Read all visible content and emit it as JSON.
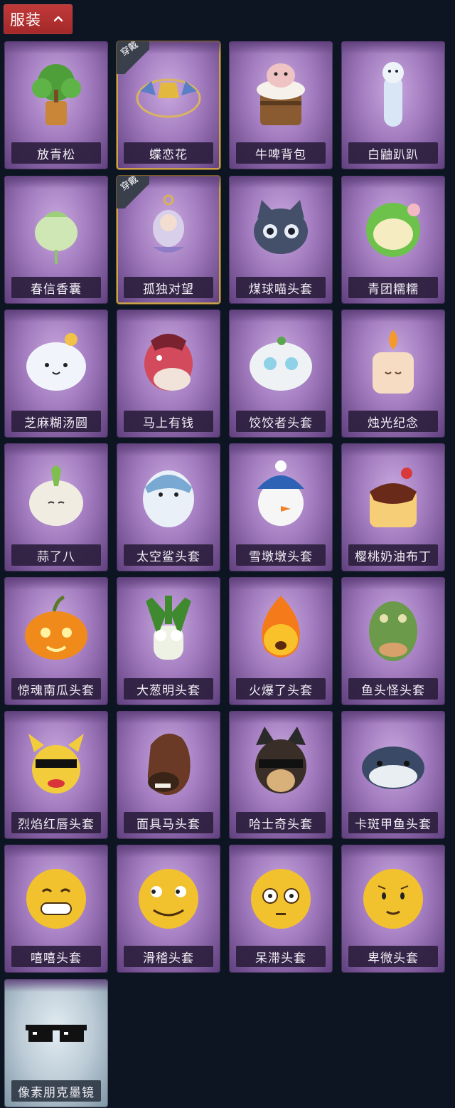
{
  "header": {
    "tab_label": "服装",
    "toggle_icon": "chevron-up-icon"
  },
  "worn_badge_label": "穿戴",
  "colors": {
    "background": "#0d1523",
    "tab_red": "#b32f2f",
    "card_purple": "#a27bbf",
    "card_silver": "#bccbd6",
    "worn_border_gold": "#c9a24a"
  },
  "items": [
    {
      "name": "放青松",
      "icon": "bonsai-pine-icon",
      "worn": false,
      "rarity": "purple"
    },
    {
      "name": "蝶恋花",
      "icon": "butterfly-bell-ornament-icon",
      "worn": true,
      "rarity": "purple"
    },
    {
      "name": "牛啤背包",
      "icon": "cow-beer-mug-backpack-icon",
      "worn": false,
      "rarity": "purple"
    },
    {
      "name": "白鼬趴趴",
      "icon": "white-weasel-plush-icon",
      "worn": false,
      "rarity": "purple"
    },
    {
      "name": "春信香囊",
      "icon": "sachet-pouch-icon",
      "worn": false,
      "rarity": "purple"
    },
    {
      "name": "孤独对望",
      "icon": "girl-charm-pendant-icon",
      "worn": true,
      "rarity": "purple"
    },
    {
      "name": "煤球喵头套",
      "icon": "gray-cat-head-icon",
      "worn": false,
      "rarity": "purple"
    },
    {
      "name": "青团糯糯",
      "icon": "green-rice-ball-icon",
      "worn": false,
      "rarity": "purple"
    },
    {
      "name": "芝麻糊汤圆",
      "icon": "sesame-dumpling-icon",
      "worn": false,
      "rarity": "purple"
    },
    {
      "name": "马上有钱",
      "icon": "red-horse-head-icon",
      "worn": false,
      "rarity": "purple"
    },
    {
      "name": "饺饺者头套",
      "icon": "dumpling-head-icon",
      "worn": false,
      "rarity": "purple"
    },
    {
      "name": "烛光纪念",
      "icon": "candle-head-icon",
      "worn": false,
      "rarity": "purple"
    },
    {
      "name": "蒜了八",
      "icon": "garlic-head-icon",
      "worn": false,
      "rarity": "purple"
    },
    {
      "name": "太空鲨头套",
      "icon": "shark-head-icon",
      "worn": false,
      "rarity": "purple"
    },
    {
      "name": "雪墩墩头套",
      "icon": "snowman-head-icon",
      "worn": false,
      "rarity": "purple"
    },
    {
      "name": "樱桃奶油布丁",
      "icon": "pudding-head-icon",
      "worn": false,
      "rarity": "purple"
    },
    {
      "name": "惊魂南瓜头套",
      "icon": "pumpkin-head-icon",
      "worn": false,
      "rarity": "purple"
    },
    {
      "name": "大葱明头套",
      "icon": "scallion-head-icon",
      "worn": false,
      "rarity": "purple"
    },
    {
      "name": "火爆了头套",
      "icon": "fire-head-icon",
      "worn": false,
      "rarity": "purple"
    },
    {
      "name": "鱼头怪头套",
      "icon": "fish-head-mask-icon",
      "worn": false,
      "rarity": "purple"
    },
    {
      "name": "烈焰红唇头套",
      "icon": "yellow-mouse-sunglasses-head-icon",
      "worn": false,
      "rarity": "purple"
    },
    {
      "name": "面具马头套",
      "icon": "horse-mask-icon",
      "worn": false,
      "rarity": "purple"
    },
    {
      "name": "哈士奇头套",
      "icon": "husky-sunglasses-head-icon",
      "worn": false,
      "rarity": "purple"
    },
    {
      "name": "卡斑甲鱼头套",
      "icon": "turtle-head-icon",
      "worn": false,
      "rarity": "purple"
    },
    {
      "name": "嘻嘻头套",
      "icon": "grin-emoji-head-icon",
      "worn": false,
      "rarity": "purple"
    },
    {
      "name": "滑稽头套",
      "icon": "smirk-emoji-head-icon",
      "worn": false,
      "rarity": "purple"
    },
    {
      "name": "呆滞头套",
      "icon": "stare-emoji-head-icon",
      "worn": false,
      "rarity": "purple"
    },
    {
      "name": "卑微头套",
      "icon": "timid-emoji-head-icon",
      "worn": false,
      "rarity": "purple"
    },
    {
      "name": "像素朋克墨镜",
      "icon": "pixel-sunglasses-icon",
      "worn": false,
      "rarity": "silver"
    }
  ]
}
